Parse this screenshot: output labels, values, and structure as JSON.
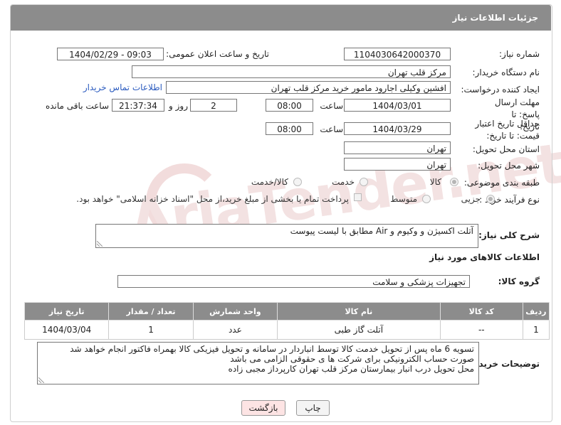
{
  "header": {
    "title": "جزئیات اطلاعات نیاز"
  },
  "watermark": {
    "text": "AriaTender.net"
  },
  "fields": {
    "need_number_label": "شماره نیاز:",
    "need_number": "1104030642000370",
    "announce_label": "تاریخ و ساعت اعلان عمومی:",
    "announce_value": "1404/02/29 - 09:03",
    "buyer_org_label": "نام دستگاه خریدار:",
    "buyer_org": "مرکز قلب تهران",
    "requester_label": "ایجاد کننده درخواست:",
    "requester": "افشین وکیلی اجارود مامور خرید مرکز قلب تهران",
    "contact_link": "اطلاعات تماس خریدار",
    "reply_deadline_label": "مهلت ارسال پاسخ: تا تاریخ:",
    "reply_date": "1404/03/01",
    "time_label": "ساعت",
    "reply_time": "08:00",
    "days_value": "2",
    "days_label": "روز و",
    "remaining_value": "21:37:34",
    "remaining_label": "ساعت باقی مانده",
    "validity_label": "حداقل تاریخ اعتبار قیمت: تا تاریخ:",
    "validity_date": "1404/03/29",
    "validity_time": "08:00",
    "province_label": "استان محل تحویل:",
    "province": "تهران",
    "city_label": "شهر محل تحویل:",
    "city": "تهران",
    "category_label": "طبقه بندی موضوعی:",
    "category_options": [
      "کالا",
      "خدمت",
      "کالا/خدمت"
    ],
    "process_label": "نوع فرآیند خرید :",
    "process_options": [
      "جزیی",
      "متوسط"
    ],
    "process_note": "پرداخت تمام یا بخشی از مبلغ خرید،از محل \"اسناد خزانه اسلامی\" خواهد بود."
  },
  "description": {
    "label": "شرح کلی نیاز:",
    "text": "آتلت اکسیژن و وکیوم و Air مطابق با لیست پیوست"
  },
  "goods": {
    "section_title": "اطلاعات کالاهای مورد نیاز",
    "group_label": "گروه کالا:",
    "group_value": "تجهیزات پزشکی و سلامت",
    "columns": [
      "ردیف",
      "کد کالا",
      "نام کالا",
      "واحد شمارش",
      "تعداد / مقدار",
      "تاریخ نیاز"
    ],
    "rows": [
      [
        "1",
        "--",
        "آتلت گاز طبی",
        "عدد",
        "1",
        "1404/03/04"
      ]
    ]
  },
  "buyer_notes": {
    "label": "توضیحات خریدار:",
    "lines": [
      "تسویه 6 ماه پس از تحویل خدمت کالا توسط انباردار در سامانه و تحویل فیزیکی کالا بهمراه فاکتور انجام خواهد شد",
      "صورت حساب الکترونیکی برای شرکت ها ی حقوقی الزامی می باشد",
      "محل تحویل درب انبار بیمارستان مرکز قلب تهران کارپرداز مجبی زاده"
    ]
  },
  "buttons": {
    "print": "چاپ",
    "back": "بازگشت"
  },
  "colors": {
    "header": "#8c8c8c",
    "back_button": "#fde4e4",
    "link": "#2b5bbf"
  }
}
